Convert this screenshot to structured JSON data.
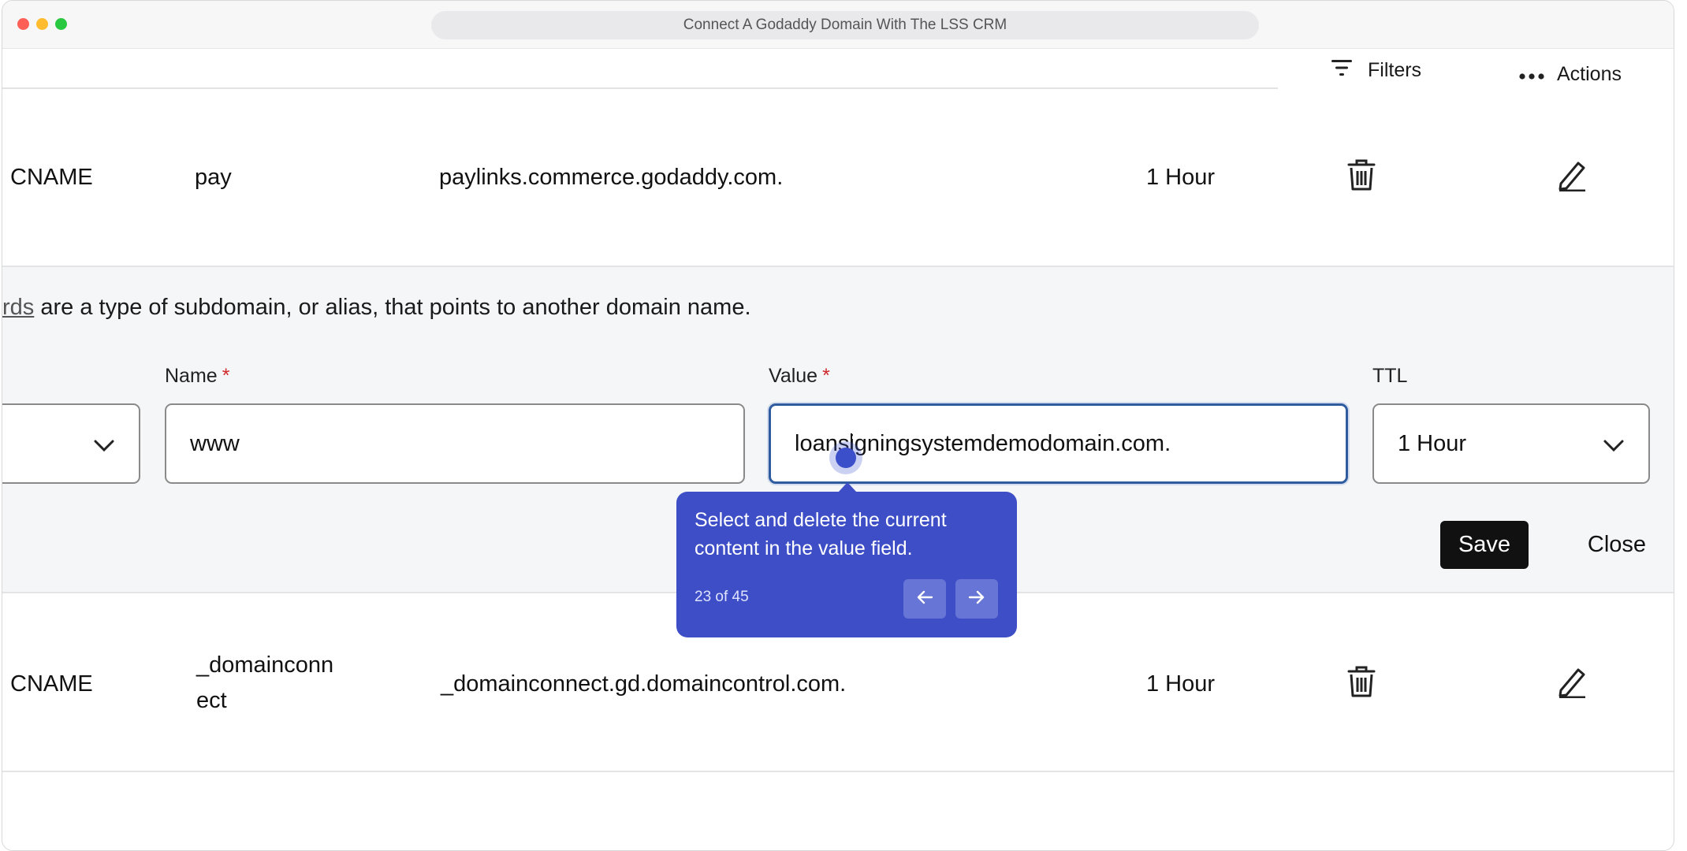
{
  "window": {
    "title": "Connect A Godaddy Domain With The LSS CRM"
  },
  "toolbar": {
    "filters_label": "Filters",
    "actions_label": "Actions"
  },
  "records": [
    {
      "type": "CNAME",
      "name": "pay",
      "value": "paylinks.commerce.godaddy.com.",
      "ttl": "1 Hour"
    },
    {
      "type": "CNAME",
      "name_line1": "_domainconn",
      "name_line2": "ect",
      "value": "_domainconnect.gd.domaincontrol.com.",
      "ttl": "1 Hour"
    }
  ],
  "edit_form": {
    "help_link": "rds",
    "help_text": " are a type of subdomain, or alias, that points to another domain name.",
    "name_label": "Name",
    "value_label": "Value",
    "ttl_label": "TTL",
    "required_mark": "*",
    "name_value": "www",
    "value_value": "loansigningsystemdemodomain.com.",
    "ttl_value": "1 Hour",
    "save_label": "Save",
    "close_label": "Close"
  },
  "tooltip": {
    "text": "Select and delete the current content in the value field.",
    "step": "23 of 45"
  },
  "icons": {
    "filter": "filter-icon",
    "more": "more-horizontal-icon",
    "delete": "trash-icon",
    "edit": "pencil-icon",
    "dropdown": "chevron-down-icon",
    "prev": "arrow-left-icon",
    "next": "arrow-right-icon"
  }
}
